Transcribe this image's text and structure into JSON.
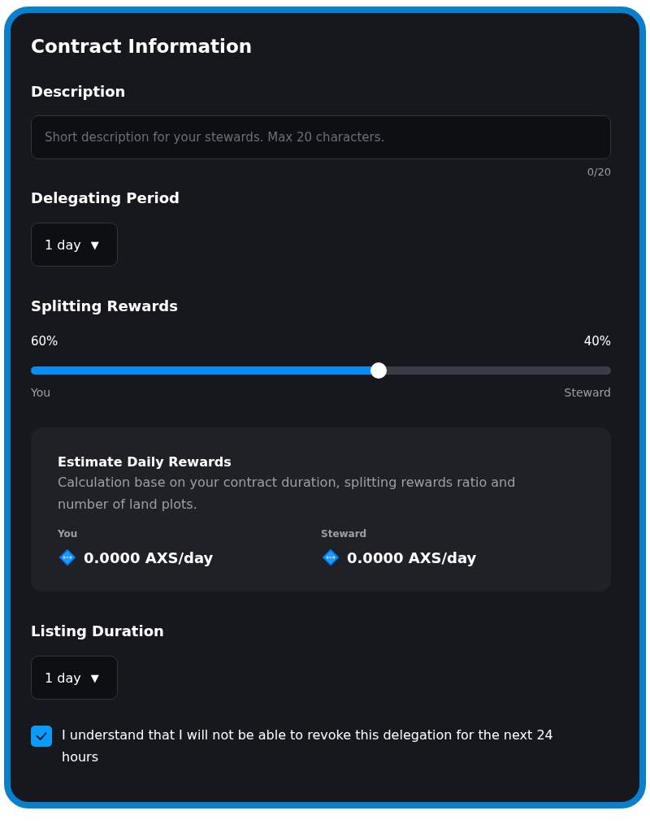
{
  "title": "Contract Information",
  "description": {
    "label": "Description",
    "placeholder": "Short description for your stewards. Max 20 characters.",
    "counter": "0/20"
  },
  "delegating_period": {
    "label": "Delegating Period",
    "value": "1 day",
    "caret": "▼"
  },
  "splitting_rewards": {
    "label": "Splitting Rewards",
    "left_percent": "60%",
    "right_percent": "40%",
    "level": 0.6,
    "left_label": "You",
    "right_label": "Steward"
  },
  "estimate": {
    "title": "Estimate Daily Rewards",
    "text": "Calculation base on your contract duration, splitting rewards ratio and number of land plots.",
    "columns": [
      {
        "label": "You",
        "value": "0.0000 AXS/day"
      },
      {
        "label": "Steward",
        "value": "0.0000 AXS/day"
      }
    ]
  },
  "listing_duration": {
    "label": "Listing Duration",
    "value": "1 day",
    "caret": "▼"
  },
  "agreement": {
    "checked": true,
    "text": "I understand that I will not be able to revoke this delegation for the next 24 hours"
  }
}
